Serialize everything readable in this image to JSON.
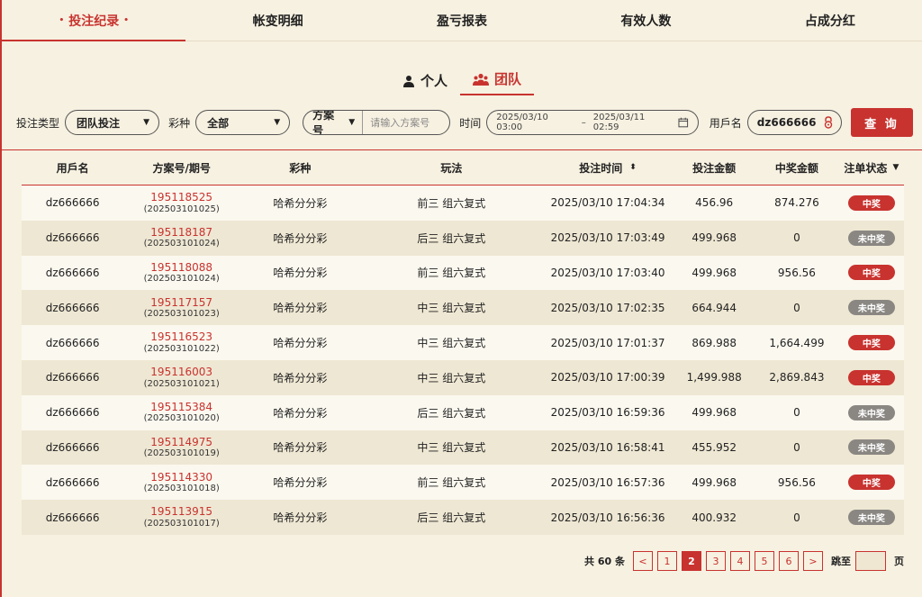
{
  "tabs": [
    "投注纪录",
    "帐变明细",
    "盈亏报表",
    "有效人数",
    "占成分红"
  ],
  "active_tab_dot": "•",
  "switch": {
    "personal": "个人",
    "team": "团队"
  },
  "filters": {
    "bet_type_label": "投注类型",
    "bet_type_value": "团队投注",
    "lottery_label": "彩种",
    "lottery_value": "全部",
    "plan_select": "方案号",
    "plan_placeholder": "请输入方案号",
    "time_label": "时间",
    "date_from": "2025/03/10 03:00",
    "date_sep": "–",
    "date_to": "2025/03/11 02:59",
    "user_label": "用戶名",
    "user_value": "dz666666",
    "query_button": "查 询"
  },
  "columns": [
    "用戶名",
    "方案号/期号",
    "彩种",
    "玩法",
    "投注时间",
    "投注金额",
    "中奖金额",
    "注单状态"
  ],
  "rows": [
    {
      "user": "dz666666",
      "plan": "195118525",
      "period": "(202503101025)",
      "lottery": "哈希分分彩",
      "play": "前三 组六复式",
      "time": "2025/03/10 17:04:34",
      "amount": "456.96",
      "prize": "874.276",
      "status": "中奖",
      "win": true
    },
    {
      "user": "dz666666",
      "plan": "195118187",
      "period": "(202503101024)",
      "lottery": "哈希分分彩",
      "play": "后三 组六复式",
      "time": "2025/03/10 17:03:49",
      "amount": "499.968",
      "prize": "0",
      "status": "未中奖",
      "win": false
    },
    {
      "user": "dz666666",
      "plan": "195118088",
      "period": "(202503101024)",
      "lottery": "哈希分分彩",
      "play": "前三 组六复式",
      "time": "2025/03/10 17:03:40",
      "amount": "499.968",
      "prize": "956.56",
      "status": "中奖",
      "win": true
    },
    {
      "user": "dz666666",
      "plan": "195117157",
      "period": "(202503101023)",
      "lottery": "哈希分分彩",
      "play": "中三 组六复式",
      "time": "2025/03/10 17:02:35",
      "amount": "664.944",
      "prize": "0",
      "status": "未中奖",
      "win": false
    },
    {
      "user": "dz666666",
      "plan": "195116523",
      "period": "(202503101022)",
      "lottery": "哈希分分彩",
      "play": "中三 组六复式",
      "time": "2025/03/10 17:01:37",
      "amount": "869.988",
      "prize": "1,664.499",
      "status": "中奖",
      "win": true
    },
    {
      "user": "dz666666",
      "plan": "195116003",
      "period": "(202503101021)",
      "lottery": "哈希分分彩",
      "play": "中三 组六复式",
      "time": "2025/03/10 17:00:39",
      "amount": "1,499.988",
      "prize": "2,869.843",
      "status": "中奖",
      "win": true
    },
    {
      "user": "dz666666",
      "plan": "195115384",
      "period": "(202503101020)",
      "lottery": "哈希分分彩",
      "play": "后三 组六复式",
      "time": "2025/03/10 16:59:36",
      "amount": "499.968",
      "prize": "0",
      "status": "未中奖",
      "win": false
    },
    {
      "user": "dz666666",
      "plan": "195114975",
      "period": "(202503101019)",
      "lottery": "哈希分分彩",
      "play": "中三 组六复式",
      "time": "2025/03/10 16:58:41",
      "amount": "455.952",
      "prize": "0",
      "status": "未中奖",
      "win": false
    },
    {
      "user": "dz666666",
      "plan": "195114330",
      "period": "(202503101018)",
      "lottery": "哈希分分彩",
      "play": "前三 组六复式",
      "time": "2025/03/10 16:57:36",
      "amount": "499.968",
      "prize": "956.56",
      "status": "中奖",
      "win": true
    },
    {
      "user": "dz666666",
      "plan": "195113915",
      "period": "(202503101017)",
      "lottery": "哈希分分彩",
      "play": "后三 组六复式",
      "time": "2025/03/10 16:56:36",
      "amount": "400.932",
      "prize": "0",
      "status": "未中奖",
      "win": false
    }
  ],
  "pagination": {
    "total": "共 60 条",
    "prev": "<",
    "next": ">",
    "pages": [
      "1",
      "2",
      "3",
      "4",
      "5",
      "6"
    ],
    "current": "2",
    "jump_label": "跳至",
    "page_unit": "页"
  },
  "colors": {
    "accent": "#c8332f",
    "background": "#f7f1e1",
    "lose_badge": "#8a8783"
  }
}
